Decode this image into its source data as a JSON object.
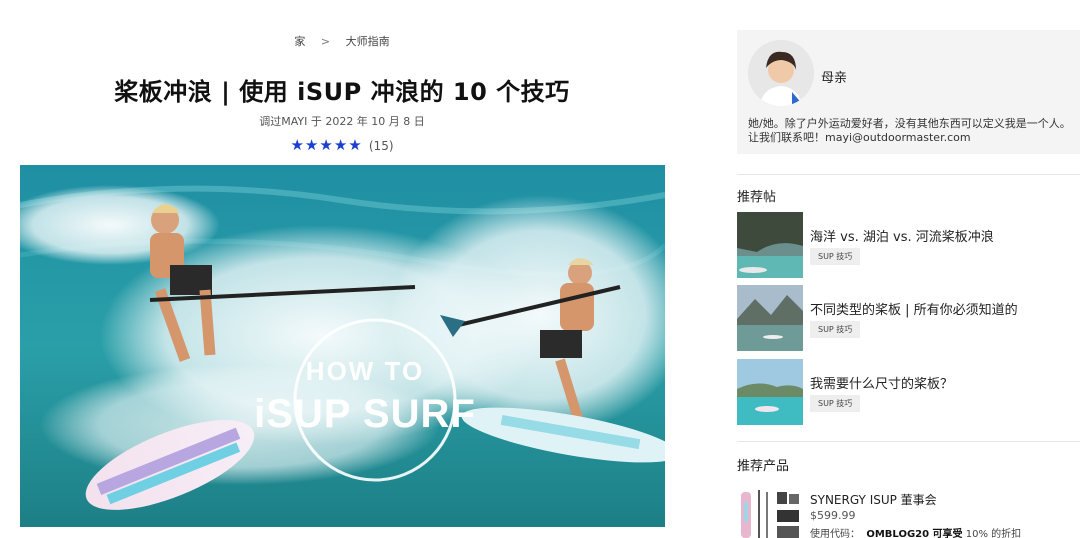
{
  "breadcrumb": {
    "home": "家",
    "separator": ">",
    "current": "大师指南"
  },
  "article": {
    "title": "桨板冲浪 | 使用 iSUP 冲浪的 10 个技巧",
    "meta": "调过MAYI 于 2022 年 10 月 8 日",
    "stars": "★★★★★",
    "rating_count": "(15)",
    "rating_value": 5,
    "hero_text_line1": "HOW TO",
    "hero_text_line2": "iSUP SURF"
  },
  "author": {
    "name": "母亲",
    "bio_line1": "她/她。除了户外运动爱好者，没有其他东西可以定义我是一个人。",
    "bio_line2": "让我们联系吧！mayi@outdoormaster.com"
  },
  "sidebar": {
    "recommended_posts_title": "推荐帖",
    "posts": [
      {
        "title": "海洋 vs. 湖泊 vs. 河流桨板冲浪",
        "tag": "SUP 技巧"
      },
      {
        "title": "不同类型的桨板 | 所有你必须知道的",
        "tag": "SUP 技巧"
      },
      {
        "title": "我需要什么尺寸的桨板？",
        "tag": "SUP 技巧"
      }
    ],
    "recommended_products_title": "推荐产品",
    "product": {
      "name": "SYNERGY ISUP 董事会",
      "price": "$599.99",
      "promo_prefix": "使用代码：",
      "promo_code": "OMBLOG20 可享受",
      "promo_suffix": "10% 的折扣"
    }
  },
  "colors": {
    "star": "#1a3fd1",
    "card_bg": "#f4f4f4",
    "tag_bg": "#eeeeee"
  },
  "icons": {
    "breadcrumb_separator": "chevron-right-icon",
    "rating": "star-icon"
  }
}
